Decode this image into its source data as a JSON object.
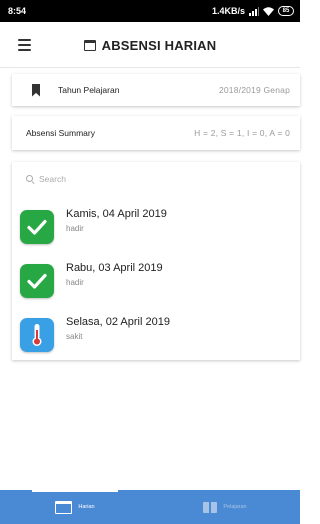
{
  "status_bar": {
    "time": "8:54",
    "network_speed": "1.4KB/s",
    "battery": "85",
    "icons": [
      "signal-icon",
      "wifi-icon",
      "battery-icon"
    ]
  },
  "app_bar": {
    "title": "ABSENSI HARIAN",
    "menu_icon": "menu-icon",
    "title_icon": "calendar-icon"
  },
  "academic_year": {
    "icon": "bookmark-icon",
    "label": "Tahun Pelajaran",
    "value": "2018/2019 Genap"
  },
  "summary": {
    "label": "Absensi Summary",
    "value": "H = 2, S = 1, I = 0, A = 0"
  },
  "search": {
    "icon": "search-icon",
    "placeholder": "Search"
  },
  "entries": [
    {
      "date": "Kamis, 04 April 2019",
      "status": "hadir",
      "icon": "check-icon",
      "color": "#27a844"
    },
    {
      "date": "Rabu, 03 April 2019",
      "status": "hadir",
      "icon": "check-icon",
      "color": "#27a844"
    },
    {
      "date": "Selasa, 02 April 2019",
      "status": "sakit",
      "icon": "thermometer-icon",
      "color": "#3aa0e6"
    }
  ],
  "bottom_nav": {
    "tabs": [
      {
        "label": "Harian",
        "icon": "calendar-icon",
        "active": true
      },
      {
        "label": "Pelajaran",
        "icon": "book-icon",
        "active": false
      }
    ],
    "background": "#4a8ad4"
  }
}
